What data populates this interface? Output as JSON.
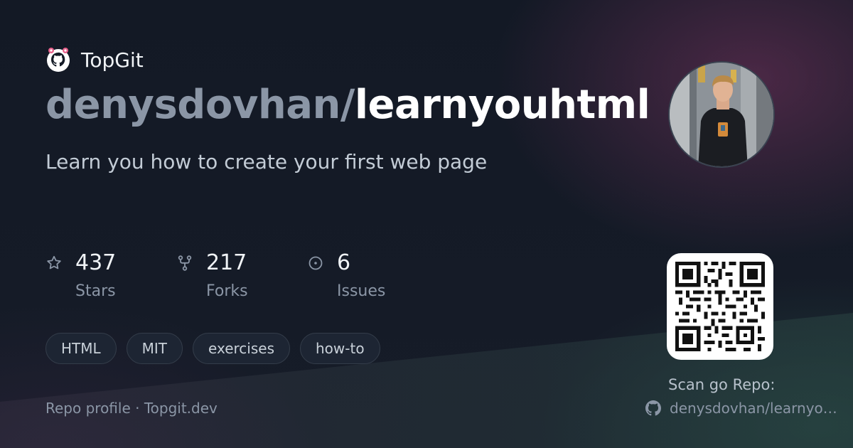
{
  "brand": {
    "name": "TopGit"
  },
  "repo": {
    "owner_prefix": "denysdovhan/",
    "name": "learnyouhtml",
    "description": "Learn you how to create your first web page"
  },
  "stats": [
    {
      "value": "437",
      "label": "Stars",
      "icon": "star-icon"
    },
    {
      "value": "217",
      "label": "Forks",
      "icon": "fork-icon"
    },
    {
      "value": "6",
      "label": "Issues",
      "icon": "issue-icon"
    }
  ],
  "tags": [
    "HTML",
    "MIT",
    "exercises",
    "how-to"
  ],
  "footer": {
    "text": "Repo profile · Topgit.dev"
  },
  "qr": {
    "caption": "Scan go Repo:",
    "repo_link": "denysdovhan/learnyouhtml"
  },
  "colors": {
    "accent_pink": "#e8618c",
    "owner_gray": "#8b96a6",
    "text_white": "#ffffff"
  }
}
